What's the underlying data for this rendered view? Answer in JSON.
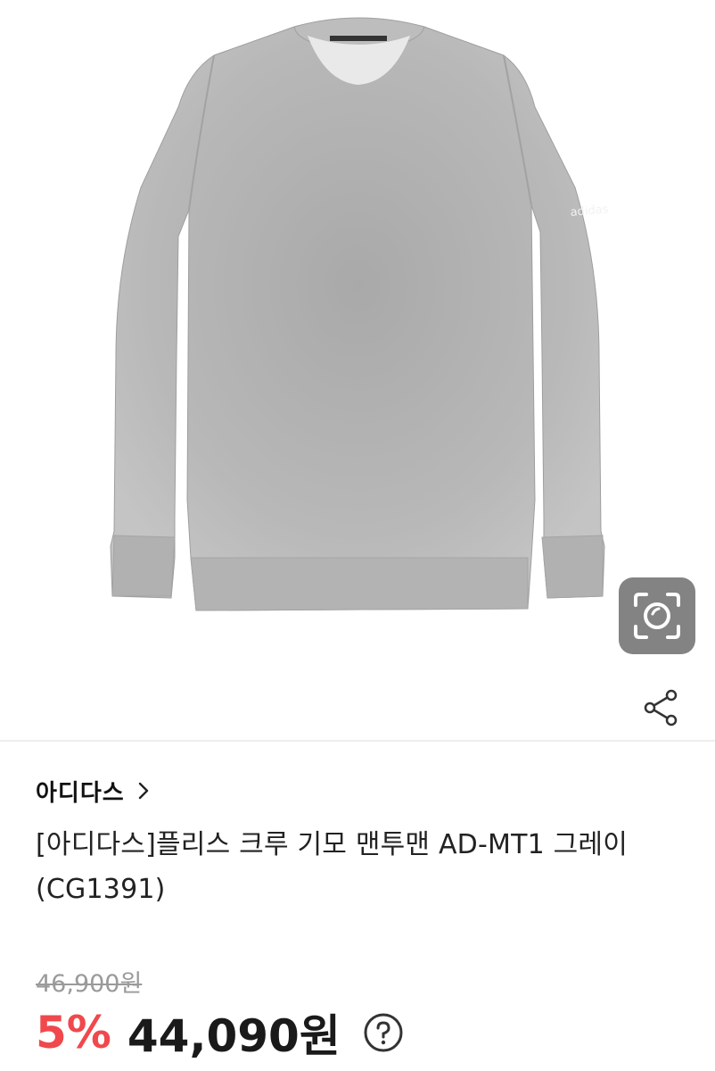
{
  "product": {
    "image_alt": "",
    "colors": {
      "background": "#ffffff",
      "fabric": "#b6b6b6",
      "discount": "#f0484c"
    }
  },
  "overlay_buttons": {
    "lens_icon": "camera-lens-icon",
    "share_icon": "share-icon"
  },
  "brand": {
    "name": "아디다스",
    "chevron_icon": "chevron-right-icon"
  },
  "title": "[아디다스]플리스 크루 기모 맨투맨 AD-MT1 그레이 (CG1391)",
  "price": {
    "original": "46,900원",
    "discount_rate": "5%",
    "sale": "44,090원",
    "help_icon": "question-circle-icon"
  }
}
